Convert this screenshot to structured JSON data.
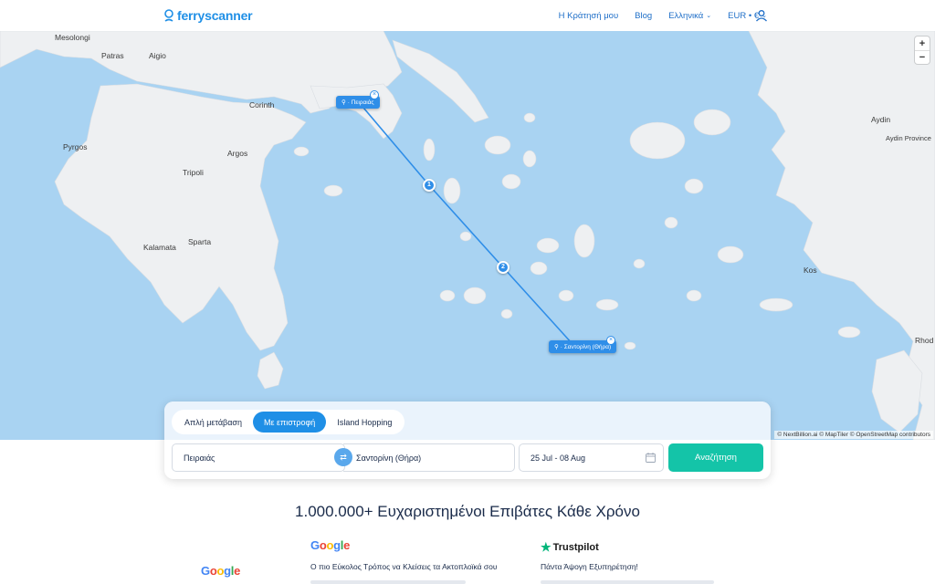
{
  "header": {
    "logo_text": "ferryscanner",
    "nav": {
      "bookings": "Η Κράτησή μου",
      "blog": "Blog",
      "language": "Ελληνικά",
      "currency": "EUR • €"
    }
  },
  "map": {
    "places": {
      "mesolongi": "Mesolongi",
      "patras": "Patras",
      "aigio": "Aigio",
      "corinth": "Corinth",
      "pyrgos": "Pyrgos",
      "argos": "Argos",
      "tripoli": "Tripoli",
      "kalamata": "Kalamata",
      "sparta": "Sparta",
      "aydin": "Aydin",
      "aydin_province": "Aydin Province",
      "kos": "Kos",
      "rhodes": "Rhod"
    },
    "origin_tag": "· Πειραιάς",
    "destination_tag": "· Σαντορίνη (Θήρα)",
    "stop_1": "1",
    "stop_2": "2",
    "zoom_in": "+",
    "zoom_out": "−",
    "attribution": "© NextBillion.ai © MapTiler © OpenStreetMap contributors",
    "colors": {
      "sea": "#a9d3f2",
      "land": "#eef0f2",
      "route": "#2f8ee8"
    }
  },
  "search": {
    "tabs": [
      "Απλή μετάβαση",
      "Με επιστροφή",
      "Island Hopping"
    ],
    "active_tab": "Με επιστροφή",
    "from_value": "Πειραιάς",
    "to_value": "Σαντορίνη (Θήρα)",
    "dates_value": "25 Jul - 08 Aug",
    "search_label": "Αναζήτηση",
    "colors": {
      "tab_active": "#1f8fe6",
      "search_button": "#14c4a8"
    }
  },
  "trust": {
    "headline_bold": "1.000.000+ Ευχαριστημένοι Επιβάτες",
    "headline_rest": " Κάθε Χρόνο",
    "google_logo": "Google",
    "google_review_title": "Ο πιο Εύκολος Τρόπος να Κλείσεις τα Ακτοπλοϊκά σου",
    "trustpilot_logo": "Trustpilot",
    "trustpilot_review_title": "Πάντα Άψογη Εξυπηρέτηση!"
  }
}
